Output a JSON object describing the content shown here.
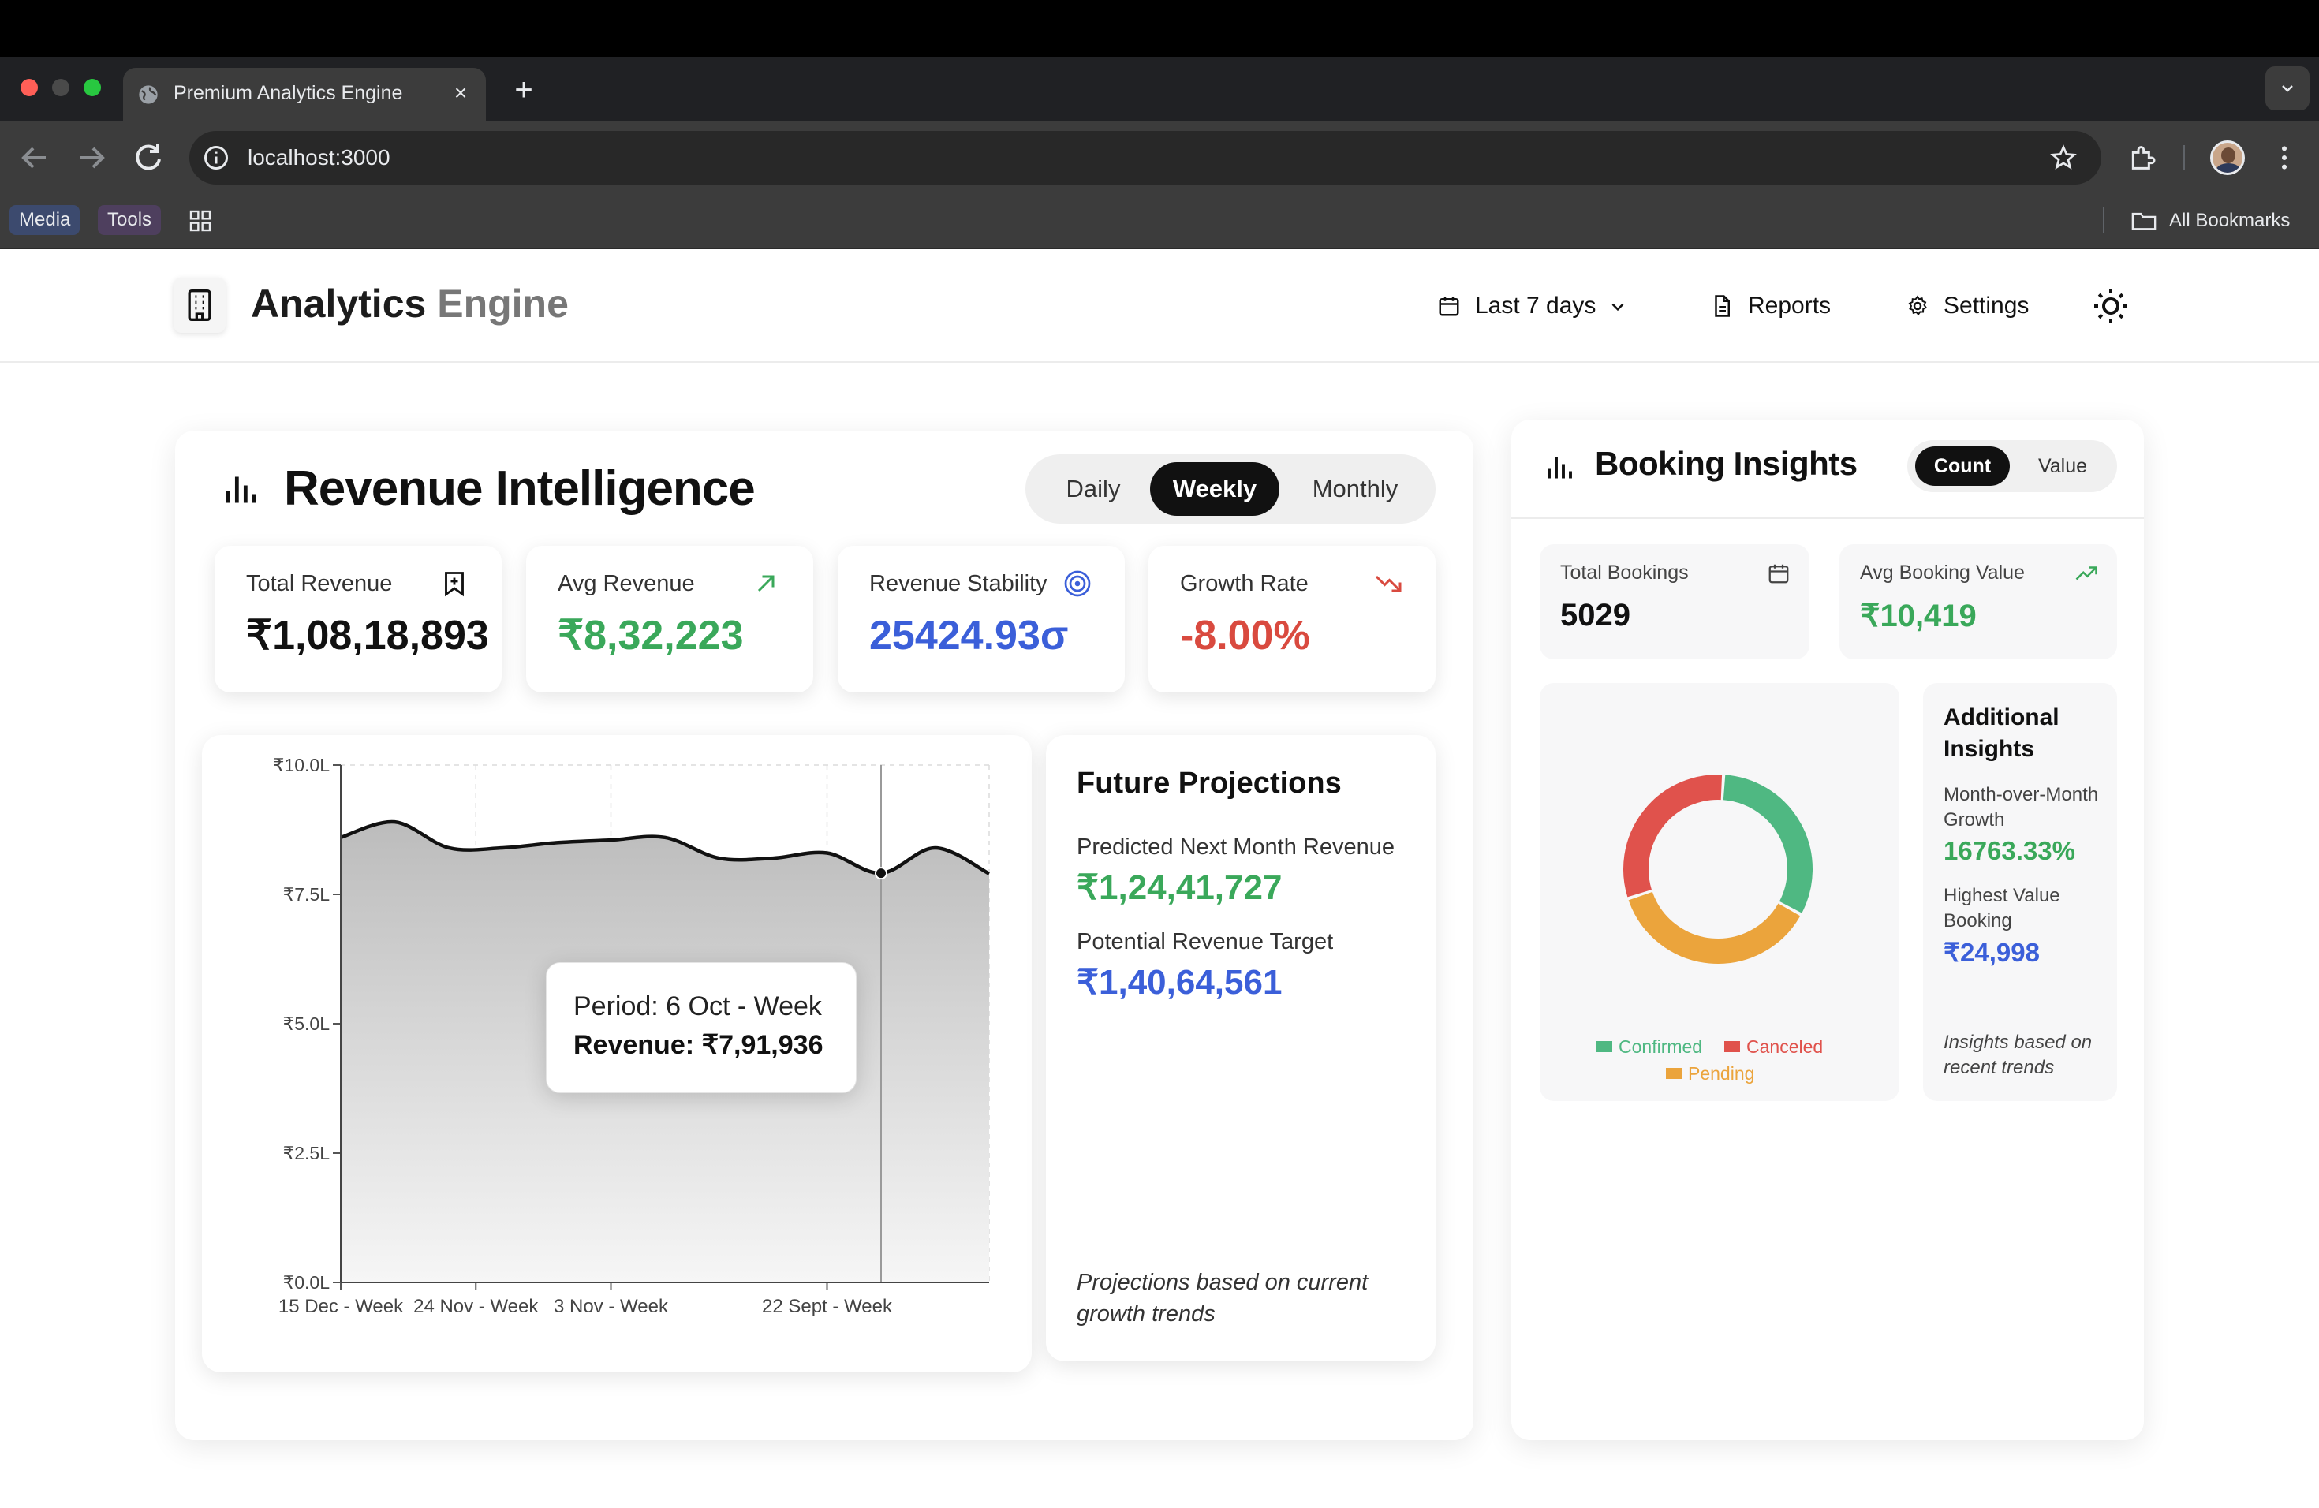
{
  "browser": {
    "tab_title": "Premium Analytics Engine",
    "url": "localhost:3000",
    "bookmarks": [
      "Media",
      "Tools"
    ],
    "all_bookmarks_label": "All Bookmarks"
  },
  "header": {
    "brand_primary": "Analytics",
    "brand_secondary": "Engine",
    "date_range": "Last 7 days",
    "reports_label": "Reports",
    "settings_label": "Settings"
  },
  "revenue": {
    "title": "Revenue Intelligence",
    "periods": [
      "Daily",
      "Weekly",
      "Monthly"
    ],
    "active_period": "Weekly",
    "kpis": [
      {
        "label": "Total Revenue",
        "value": "₹1,08,18,893",
        "icon": "bookmark-plus-icon",
        "color": "#111111"
      },
      {
        "label": "Avg Revenue",
        "value": "₹8,32,223",
        "icon": "arrow-up-right-icon",
        "color": "#3aa85a"
      },
      {
        "label": "Revenue Stability",
        "value": "25424.93σ",
        "icon": "target-icon",
        "color": "#3b5fd9"
      },
      {
        "label": "Growth Rate",
        "value": "-8.00%",
        "icon": "trending-down-icon",
        "color": "#d94a3f"
      }
    ]
  },
  "chart_data": {
    "type": "area",
    "x_ticks": [
      "15 Dec - Week",
      "24 Nov - Week",
      "3 Nov - Week",
      "22 Sept - Week"
    ],
    "y_ticks": [
      "₹0.0L",
      "₹2.5L",
      "₹5.0L",
      "₹7.5L",
      "₹10.0L"
    ],
    "ylim": [
      0,
      10
    ],
    "y_unit": "L",
    "series": [
      {
        "values": [
          8.6,
          8.9,
          8.4,
          8.4,
          8.5,
          8.55,
          8.6,
          8.2,
          8.2,
          8.3,
          7.91,
          8.4,
          7.9
        ]
      }
    ],
    "grid": true,
    "tooltip": {
      "period": "Period: 6 Oct - Week",
      "revenue": "Revenue: ₹7,91,936"
    }
  },
  "projections": {
    "title": "Future Projections",
    "items": [
      {
        "label": "Predicted Next Month Revenue",
        "value": "₹1,24,41,727",
        "color": "#3aa85a"
      },
      {
        "label": "Potential Revenue Target",
        "value": "₹1,40,64,561",
        "color": "#3b5fd9"
      }
    ],
    "note": "Projections based on current growth trends"
  },
  "booking": {
    "title": "Booking Insights",
    "modes": [
      "Count",
      "Value"
    ],
    "active_mode": "Count",
    "kpis": [
      {
        "label": "Total Bookings",
        "value": "5029",
        "icon": "calendar-icon",
        "color": "#111111"
      },
      {
        "label": "Avg Booking Value",
        "value": "₹10,419",
        "icon": "trending-up-icon",
        "color": "#3aa85a"
      }
    ],
    "donut": {
      "segments": [
        {
          "name": "Confirmed",
          "share": 0.32,
          "color": "#4fb882"
        },
        {
          "name": "Pending",
          "share": 0.37,
          "color": "#eba43c"
        },
        {
          "name": "Canceled",
          "share": 0.31,
          "color": "#e0524c"
        }
      ]
    },
    "additional": {
      "title": "Additional Insights",
      "growth_label": "Month-over-Month Growth",
      "growth_value": "16763.33%",
      "highest_label": "Highest Value Booking",
      "highest_value": "₹24,998",
      "note": "Insights based on recent trends"
    }
  }
}
